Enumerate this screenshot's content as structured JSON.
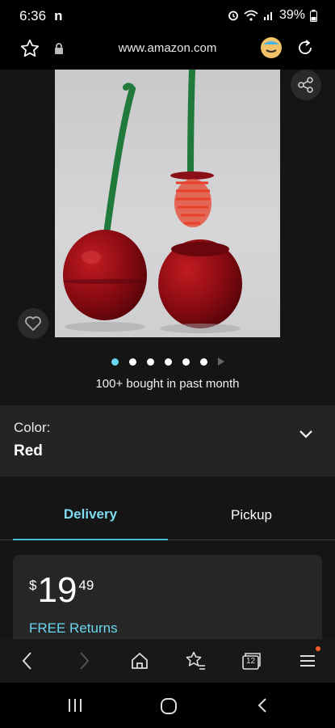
{
  "status_bar": {
    "time": "6:36",
    "extra_glyph": "n",
    "battery": "39%",
    "icons": [
      "alarm-icon",
      "wifi-icon",
      "signal-icon",
      "battery-icon"
    ]
  },
  "browser": {
    "url": "www.amazon.com",
    "icons": [
      "star-icon",
      "lock-icon",
      "amazon-assistant-icon",
      "reload-icon"
    ]
  },
  "product": {
    "image_alt": "Red cherry-shaped toilet brush set with green stems",
    "bought_text": "100+ bought in past month",
    "carousel": {
      "dot_count": 6,
      "active_index": 0
    },
    "color_label": "Color:",
    "color_value": "Red"
  },
  "tabs": [
    {
      "label": "Delivery",
      "active": true
    },
    {
      "label": "Pickup",
      "active": false
    }
  ],
  "price": {
    "currency": "$",
    "whole": "19",
    "fraction": "49",
    "free_returns": "FREE Returns"
  },
  "toolbar": {
    "items": [
      "back-icon",
      "forward-icon",
      "home-icon",
      "bookmarks-icon",
      "tabs-icon",
      "menu-icon"
    ],
    "tab_count": "12"
  },
  "nav_bar": {
    "items": [
      "recents-icon",
      "home-circle-icon",
      "back-nav-icon"
    ]
  },
  "colors": {
    "accent": "#6ad7f0",
    "background": "#151515",
    "card": "#262626"
  }
}
